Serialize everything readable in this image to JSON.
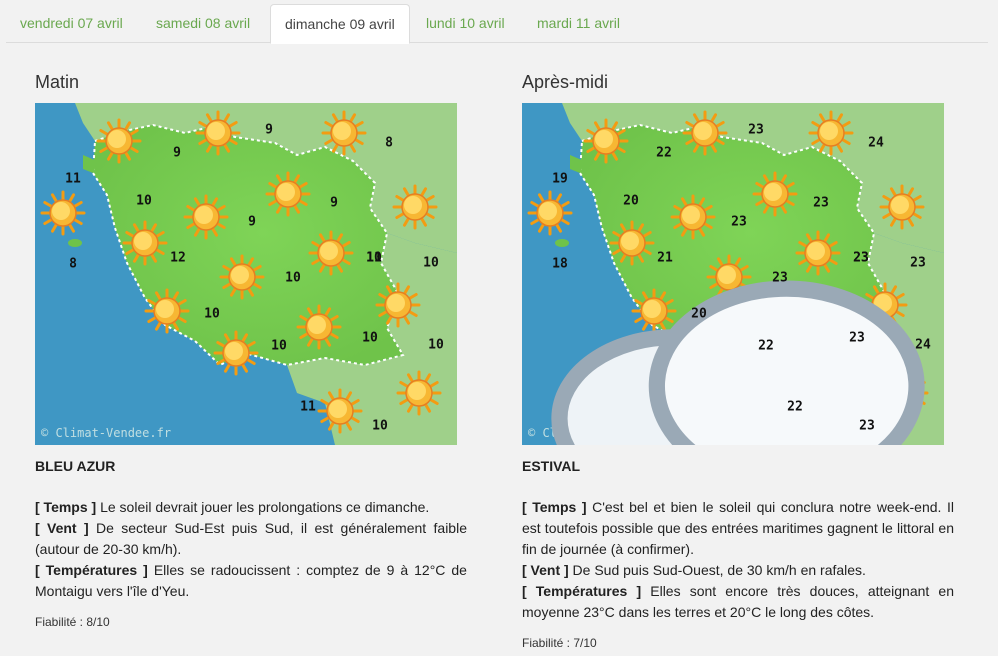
{
  "tabs": [
    {
      "label": "vendredi 07 avril",
      "active": false
    },
    {
      "label": "samedi 08 avril",
      "active": false
    },
    {
      "label": "dimanche 09 avril",
      "active": true
    },
    {
      "label": "lundi 10 avril",
      "active": false
    },
    {
      "label": "mardi 11 avril",
      "active": false
    }
  ],
  "colors": {
    "accent": "#6aa84f",
    "sea": "#3f97c4",
    "land": "#6fc34a",
    "neighbor": "#9fd08a"
  },
  "watermark": "© Climat-Vendee.fr",
  "morning": {
    "title": "Matin",
    "forecast": "BLEU AZUR",
    "temps_key": "[ Temps ]",
    "temps_text": " Le soleil devrait jouer les prolongations ce dimanche.",
    "vent_key": "[ Vent ]",
    "vent_text": " De secteur Sud-Est puis Sud, il est généralement faible (autour de 20-30 km/h).",
    "temp_key": "[ Températures ]",
    "temp_text": " Elles se radoucissent : comptez de 9 à 12°C de Montaigu vers l'île d'Yeu.",
    "fiabilite": "Fiabilité : 8/10",
    "temperatures": [
      "9",
      "8",
      "9",
      "11",
      "10",
      "9",
      "9",
      "10",
      "10",
      "8",
      "12",
      "10",
      "11",
      "10",
      "10",
      "10",
      "10",
      "11",
      "10"
    ]
  },
  "afternoon": {
    "title": "Après-midi",
    "forecast": "ESTIVAL",
    "temps_key": "[ Temps ]",
    "temps_text": " C'est bel et bien le soleil qui conclura notre week-end. Il est toutefois possible que des entrées maritimes gagnent le littoral en fin de journée (à confirmer).",
    "vent_key": "[ Vent ]",
    "vent_text": " De Sud puis Sud-Ouest, de 30 km/h en rafales.",
    "temp_key": "[ Températures ]",
    "temp_text": " Elles sont encore très douces, atteignant en moyenne 23°C dans les terres et 20°C le long des côtes.",
    "fiabilite": "Fiabilité : 7/10",
    "temperatures": [
      "23",
      "24",
      "22",
      "19",
      "20",
      "23",
      "23",
      "23",
      "23",
      "18",
      "21",
      "23",
      "23",
      "20",
      "22",
      "23",
      "24",
      "22",
      "23"
    ]
  }
}
